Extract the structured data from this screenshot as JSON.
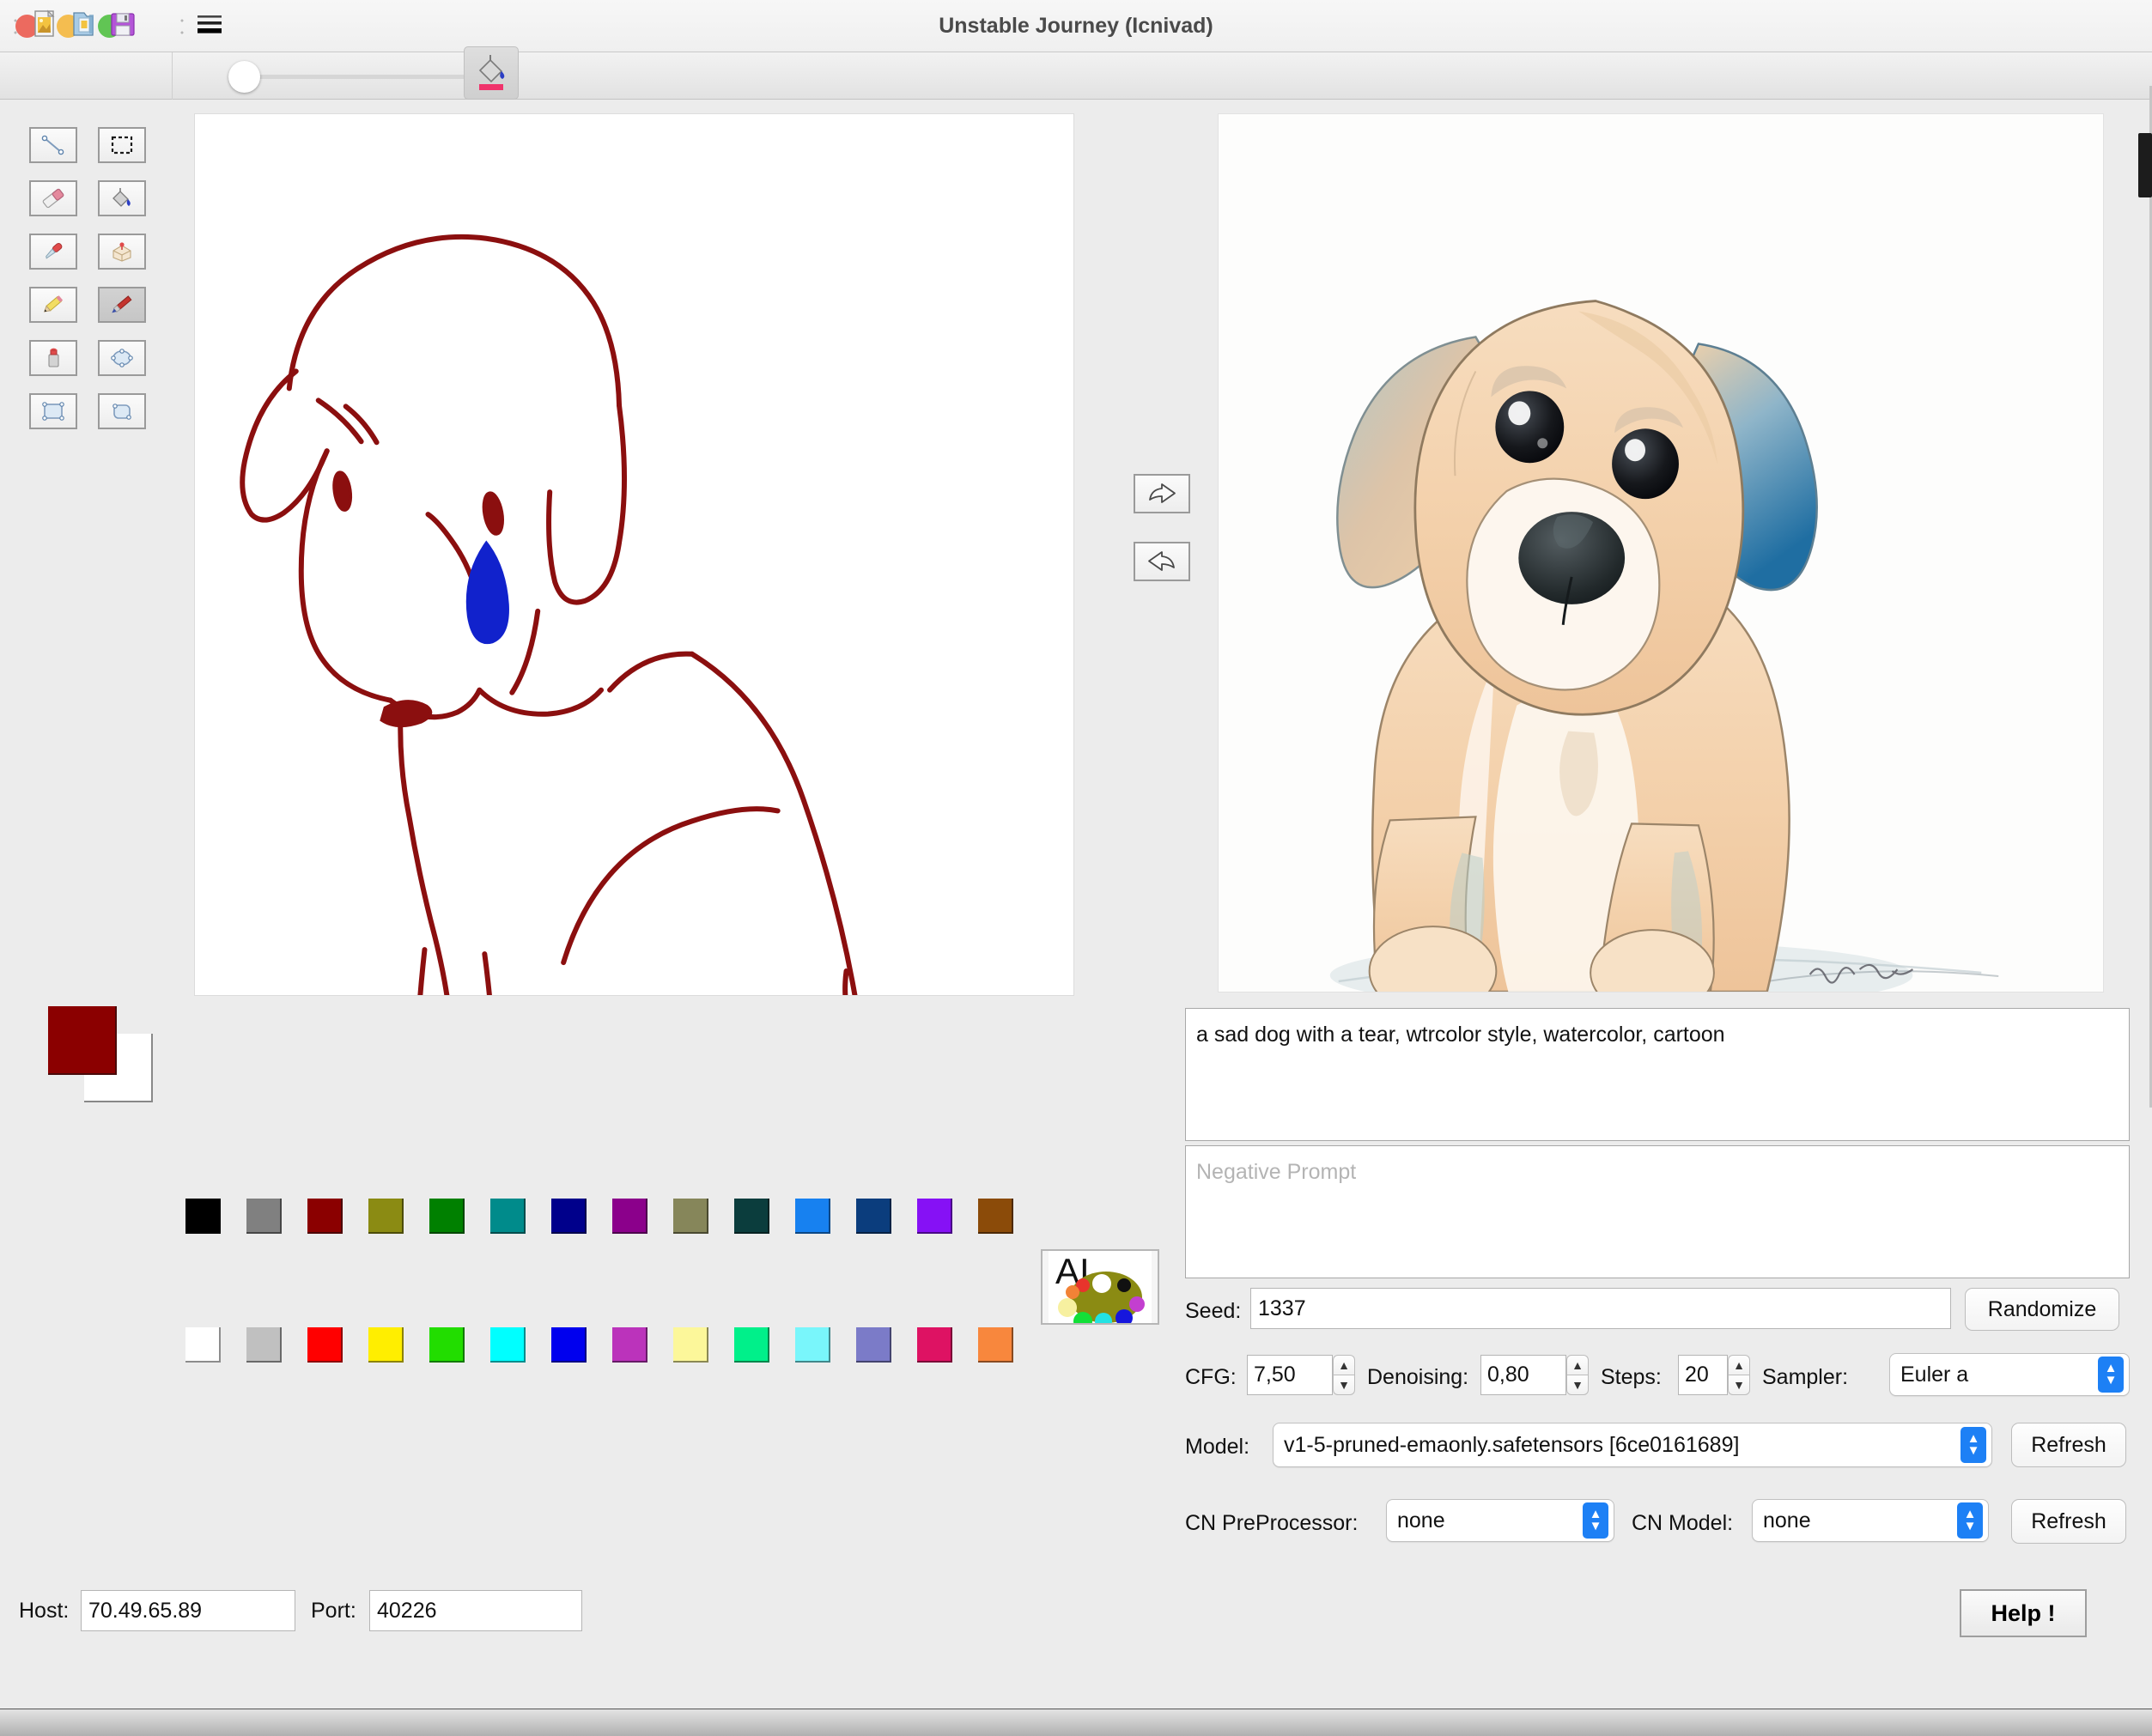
{
  "window": {
    "title": "Unstable Journey (Icnivad)",
    "traffic_lights": [
      "close",
      "minimize",
      "zoom"
    ]
  },
  "toolbar": {
    "items": [
      {
        "name": "new-image-icon",
        "label": "New Image"
      },
      {
        "name": "open-file-icon",
        "label": "Open"
      },
      {
        "name": "save-floppy-icon",
        "label": "Save"
      },
      {
        "name": "brush-size-list-icon",
        "label": "Brush Size"
      }
    ],
    "slider": {
      "name": "brush-size-slider",
      "value": 0
    },
    "fill_tool": {
      "name": "paint-bucket-color-button",
      "label": "Fill Color",
      "accent": "#f0336c"
    }
  },
  "tools": {
    "rows": [
      [
        {
          "name": "line-tool",
          "label": "Line",
          "active": false
        },
        {
          "name": "rect-select-tool",
          "label": "Rectangle Select",
          "active": false
        }
      ],
      [
        {
          "name": "eraser-tool",
          "label": "Eraser",
          "active": false
        },
        {
          "name": "fill-bucket-tool",
          "label": "Fill Bucket",
          "active": false
        }
      ],
      [
        {
          "name": "color-picker-tool",
          "label": "Color Picker",
          "active": false
        },
        {
          "name": "stamp-tool",
          "label": "Stamp",
          "active": false
        }
      ],
      [
        {
          "name": "pencil-tool",
          "label": "Pencil",
          "active": false
        },
        {
          "name": "brush-tool",
          "label": "Brush",
          "active": true
        }
      ],
      [
        {
          "name": "spray-can-tool",
          "label": "Spray Can",
          "active": false
        },
        {
          "name": "ellipse-tool",
          "label": "Ellipse",
          "active": false
        }
      ],
      [
        {
          "name": "rectangle-tool",
          "label": "Rectangle",
          "active": false
        },
        {
          "name": "rounded-rect-tool",
          "label": "Rounded Rectangle",
          "active": false
        }
      ]
    ]
  },
  "transfer": {
    "to_result": {
      "name": "send-to-result-icon",
      "label": "Send drawing to generator"
    },
    "to_canvas": {
      "name": "send-to-canvas-icon",
      "label": "Send result back to canvas"
    }
  },
  "colors": {
    "foreground": "#8b0000",
    "background": "#ffffff",
    "palette_dark": [
      "#000000",
      "#808080",
      "#8b0000",
      "#8b8b13",
      "#008000",
      "#008b8b",
      "#00008b",
      "#8b008b",
      "#86865a",
      "#0b3d3d",
      "#1781f0",
      "#0b3d7d",
      "#8611f5",
      "#8b4b09"
    ],
    "palette_light": [
      "#ffffff",
      "#c0c0c0",
      "#ff0000",
      "#ffee00",
      "#22dd00",
      "#00ffff",
      "#0000ee",
      "#bb33bb",
      "#fcf79a",
      "#00f08a",
      "#79f6fb",
      "#7b7bc8",
      "#de1263",
      "#f8873d"
    ]
  },
  "ai_palette_button": {
    "name": "ai-palette-button",
    "label": "AI"
  },
  "generation": {
    "prompt": "a sad dog with a tear, wtrcolor style, watercolor, cartoon",
    "negative_prompt": "",
    "negative_prompt_placeholder": "Negative Prompt",
    "seed_label": "Seed:",
    "seed": "1337",
    "randomize_label": "Randomize",
    "cfg_label": "CFG:",
    "cfg": "7,50",
    "denoising_label": "Denoising:",
    "denoising": "0,80",
    "steps_label": "Steps:",
    "steps": "20",
    "sampler_label": "Sampler:",
    "sampler": "Euler a",
    "model_label": "Model:",
    "model": "v1-5-pruned-emaonly.safetensors [6ce0161689]",
    "model_refresh_label": "Refresh",
    "cn_preprocessor_label": "CN PreProcessor:",
    "cn_preprocessor": "none",
    "cn_model_label": "CN Model:",
    "cn_model": "none",
    "cn_refresh_label": "Refresh"
  },
  "connection": {
    "host_label": "Host:",
    "host": "70.49.65.89",
    "port_label": "Port:",
    "port": "40226"
  },
  "help": {
    "label": "Help !"
  },
  "canvas": {
    "description": "hand-drawn sad dog outline in dark red with a blue tear",
    "stroke_color": "#8b0f0f",
    "tear_color": "#1122cc",
    "background": "#ffffff"
  },
  "result": {
    "description": "watercolor cartoon puppy with blue-tinted ears sitting",
    "background": "#fdfdfc"
  }
}
